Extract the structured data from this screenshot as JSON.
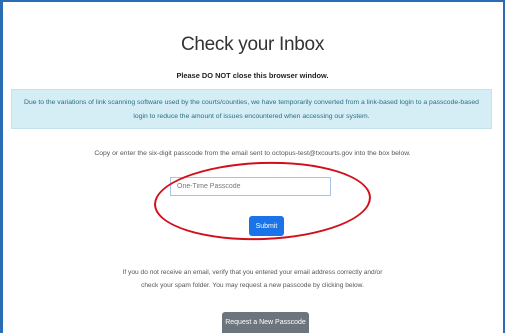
{
  "page": {
    "title": "Check your Inbox",
    "warning": "Please DO NOT close this browser window.",
    "notice_line1": "Due to the variations of link scanning software used by the courts/counties, we have temporarily converted from a link-based login to a passcode-based",
    "notice_line2": "login to reduce the amount of issues encountered when accessing our system.",
    "instruction": "Copy or enter the six-digit passcode from the email sent to octopus-test@txcourts.gov into the box below.",
    "passcode_input": {
      "value": "",
      "placeholder": "One-Time Passcode"
    },
    "submit_label": "Submit",
    "help_line1": "If you do not receive an email, verify that you entered your email address correctly and/or",
    "help_line2": "check your spam folder. You may request a new passcode by clicking below.",
    "request_label": "Request a New Passcode"
  },
  "colors": {
    "frame_border": "#2a6db5",
    "notice_bg": "#d5edf4",
    "notice_text": "#2b6f86",
    "submit_bg": "#1a73e8",
    "request_bg": "#6c757d",
    "annotation_ring": "#d20f1a"
  }
}
